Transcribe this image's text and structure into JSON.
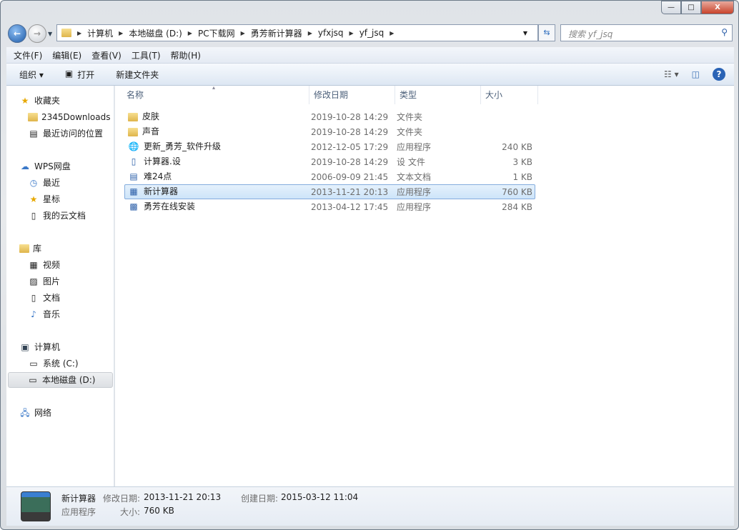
{
  "window": {
    "controls": [
      "—",
      "□",
      "X"
    ]
  },
  "address": {
    "crumbs": [
      "计算机",
      "本地磁盘 (D:)",
      "PC下载网",
      "勇芳新计算器",
      "yfxjsq",
      "yf_jsq"
    ],
    "search_placeholder": "搜索 yf_jsq"
  },
  "menu": [
    "文件(F)",
    "编辑(E)",
    "查看(V)",
    "工具(T)",
    "帮助(H)"
  ],
  "toolbar": {
    "organize": "组织 ▾",
    "open": "打开",
    "new_folder": "新建文件夹"
  },
  "sidebar": {
    "favorites": {
      "label": "收藏夹",
      "items": [
        "2345Downloads",
        "最近访问的位置"
      ]
    },
    "wps": {
      "label": "WPS网盘",
      "items": [
        "最近",
        "星标",
        "我的云文档"
      ]
    },
    "library": {
      "label": "库",
      "items": [
        "视频",
        "图片",
        "文档",
        "音乐"
      ]
    },
    "computer": {
      "label": "计算机",
      "items": [
        "系统 (C:)",
        "本地磁盘 (D:)"
      ]
    },
    "network": {
      "label": "网络"
    }
  },
  "columns": [
    "名称",
    "修改日期",
    "类型",
    "大小"
  ],
  "files": [
    {
      "name": "皮肤",
      "date": "2019-10-28 14:29",
      "type": "文件夹",
      "size": ""
    },
    {
      "name": "声音",
      "date": "2019-10-28 14:29",
      "type": "文件夹",
      "size": ""
    },
    {
      "name": "更新_勇芳_软件升级",
      "date": "2012-12-05 17:29",
      "type": "应用程序",
      "size": "240 KB"
    },
    {
      "name": "计算器.设",
      "date": "2019-10-28 14:29",
      "type": "设 文件",
      "size": "3 KB"
    },
    {
      "name": "难24点",
      "date": "2006-09-09 21:45",
      "type": "文本文档",
      "size": "1 KB"
    },
    {
      "name": "新计算器",
      "date": "2013-11-21 20:13",
      "type": "应用程序",
      "size": "760 KB"
    },
    {
      "name": "勇芳在线安装",
      "date": "2013-04-12 17:45",
      "type": "应用程序",
      "size": "284 KB"
    }
  ],
  "details": {
    "name": "新计算器",
    "modified_label": "修改日期:",
    "modified": "2013-11-21 20:13",
    "created_label": "创建日期:",
    "created": "2015-03-12 11:04",
    "type": "应用程序",
    "size_label": "大小:",
    "size": "760 KB"
  }
}
